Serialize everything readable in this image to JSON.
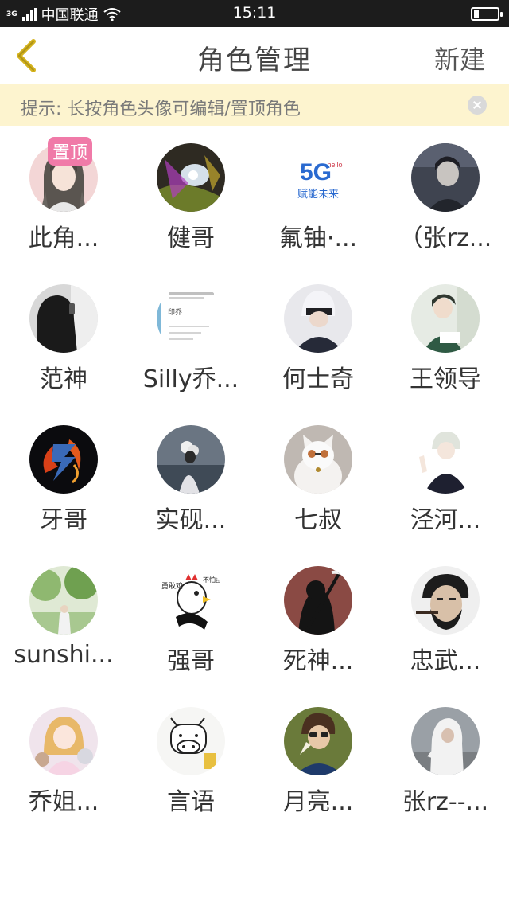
{
  "status_bar": {
    "network_type": "3G",
    "carrier": "中国联通",
    "time": "15:11",
    "battery_level": 0.2
  },
  "nav": {
    "back_icon": "chevron-left-icon",
    "title": "角色管理",
    "new_label": "新建",
    "accent_color": "#d4b21c"
  },
  "tip": {
    "text": "提示: 长按角色头像可编辑/置顶角色",
    "close_icon": "close-circle-icon",
    "background": "#fdf4cf"
  },
  "pin_badge_label": "置顶",
  "roles": [
    {
      "name": "此角...",
      "avatar": "anime-girl-avatar",
      "pinned": true
    },
    {
      "name": "健哥",
      "avatar": "colorful-light-avatar"
    },
    {
      "name": "氟铀·...",
      "avatar": "5g-logo-avatar",
      "logo_text": "5G",
      "logo_small": "hello",
      "logo_caption": "赋能未来"
    },
    {
      "name": "（张rz...",
      "avatar": "dark-anime-boy-avatar"
    },
    {
      "name": "范神",
      "avatar": "hooded-figure-avatar"
    },
    {
      "name": "Silly乔...",
      "avatar": "document-avatar",
      "doc_text": "印乔"
    },
    {
      "name": "何士奇",
      "avatar": "white-hair-anime-avatar"
    },
    {
      "name": "王领导",
      "avatar": "anime-boy-reading-avatar"
    },
    {
      "name": "牙哥",
      "avatar": "fire-logo-avatar"
    },
    {
      "name": "实砚...",
      "avatar": "person-flowers-avatar"
    },
    {
      "name": "七叔",
      "avatar": "white-cat-avatar"
    },
    {
      "name": "泾河...",
      "avatar": "anime-boy-peace-avatar"
    },
    {
      "name": "sunshi...",
      "avatar": "green-trees-avatar"
    },
    {
      "name": "强哥",
      "avatar": "rooster-cartoon-avatar",
      "side_left": "勇敢鸡",
      "side_right": "不怕困难"
    },
    {
      "name": "死神...",
      "avatar": "reaper-avatar"
    },
    {
      "name": "忠武...",
      "avatar": "bearded-man-avatar"
    },
    {
      "name": "乔姐...",
      "avatar": "anime-girl-bears-avatar"
    },
    {
      "name": "言语",
      "avatar": "cow-doodle-avatar"
    },
    {
      "name": "月亮...",
      "avatar": "curly-hair-boy-avatar"
    },
    {
      "name": "张rz--...",
      "avatar": "hooded-person-street-avatar"
    }
  ]
}
